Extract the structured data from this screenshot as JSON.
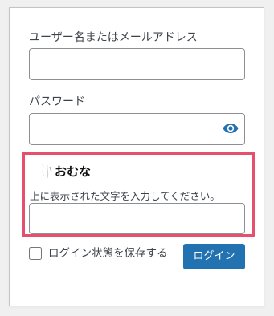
{
  "login_form": {
    "username_label": "ユーザー名またはメールアドレス",
    "username_value": "",
    "password_label": "パスワード",
    "password_value": "",
    "show_password_icon": "eye-icon",
    "captcha": {
      "image_text": "おむな",
      "instruction": "上に表示された文字を入力してください。",
      "value": "",
      "border_color": "#e5506f"
    },
    "remember_label": "ログイン状態を保存する",
    "remember_checked": false,
    "login_button_label": "ログイン",
    "accent_color": "#2271b1"
  }
}
